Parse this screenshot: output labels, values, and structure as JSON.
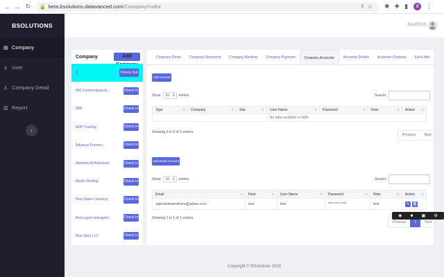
{
  "browser": {
    "url_host": "beta.bsolutions.datavanced.com",
    "url_path": "/Company/Index",
    "profile_initial": "d"
  },
  "sidebar": {
    "brand": "BSOLUTIONS",
    "items": [
      {
        "label": "Company",
        "icon": "building-icon"
      },
      {
        "label": "User",
        "icon": "user-icon"
      },
      {
        "label": "Company Detail",
        "icon": "user-icon"
      },
      {
        "label": "Report",
        "icon": "report-icon"
      }
    ]
  },
  "header": {
    "username": "RAJEEV3"
  },
  "company_panel": {
    "title": "Company",
    "add_label": "Add Company",
    "companies": [
      {
        "name": "1",
        "action": "Check Out"
      },
      {
        "name": "600 Communipaw A...",
        "action": "Check In"
      },
      {
        "name": "ABF",
        "action": "Check In"
      },
      {
        "name": "ADP Tracking",
        "action": "Check In"
      },
      {
        "name": "Advance Framers",
        "action": "Check In"
      },
      {
        "name": "Akomlec Architectural",
        "action": "Check In"
      },
      {
        "name": "Apollo Roofing",
        "action": "Check In"
      },
      {
        "name": "Best Super Cleaning",
        "action": "Check In"
      },
      {
        "name": "Best super managem...",
        "action": "Check In"
      },
      {
        "name": "Blue Saks LLC",
        "action": "Check In"
      }
    ]
  },
  "tabs": [
    "Company Detail",
    "Company Document",
    "Company Banking",
    "Company Payment",
    "Company Accounts",
    "Accounts Details",
    "Accounts Contacts",
    "Extra Info"
  ],
  "accounts": {
    "add_label": "Add Account",
    "show_label": "Show",
    "entries_value": "10",
    "entries_label": "entries",
    "search_label": "Search:",
    "columns": [
      "Type",
      "Company",
      "Site",
      "User Name",
      "Password",
      "Note",
      "Action"
    ],
    "empty_text": "No data available in table",
    "info": "Showing 0 to 0 of 0 entries",
    "prev": "Previous",
    "next": "Next"
  },
  "email_accounts": {
    "add_label": "Add Email Account",
    "show_label": "Show",
    "entries_value": "10",
    "entries_label": "entries",
    "search_label": "Search:",
    "columns": [
      "Email",
      "Host",
      "User Name",
      "Password",
      "Note",
      "Action"
    ],
    "rows": [
      {
        "email": "rajeevkumarrathore@yahoo.co.in",
        "host": "test",
        "username": "test",
        "password": "**** **** ****",
        "note": "test"
      }
    ],
    "info": "Showing 1 to 1 of 1 entries",
    "prev": "Previous",
    "page": "1",
    "next": "Next"
  },
  "footer": "Copyright © BSolutions 2020",
  "colors": {
    "primary": "#5867dd",
    "selected_row": "#00f5f5",
    "sidebar": "#1e1e2d"
  }
}
